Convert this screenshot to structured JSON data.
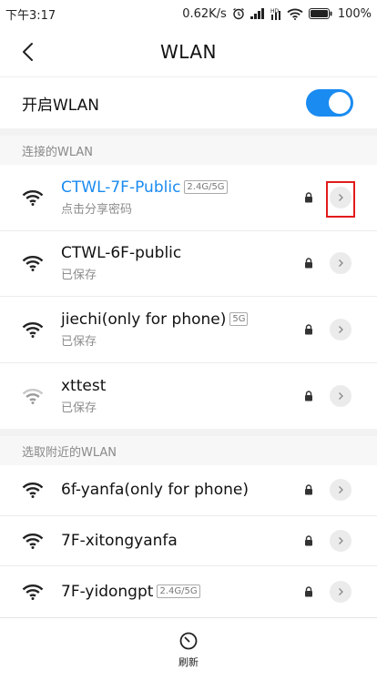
{
  "status_bar": {
    "time": "下午3:17",
    "speed": "0.62K/s",
    "battery": "100%",
    "icons": [
      "alarm-icon",
      "signal-icon",
      "hd-icon",
      "wifi-icon",
      "battery-icon"
    ]
  },
  "header": {
    "title": "WLAN",
    "back_icon": "back-arrow-icon"
  },
  "toggle": {
    "label": "开启WLAN",
    "enabled": true
  },
  "connected_section": {
    "title": "连接的WLAN",
    "items": [
      {
        "ssid": "CTWL-7F-Public",
        "badge": "2.4G/5G",
        "sub": "点击分享密码",
        "active": true,
        "locked": true,
        "signal": "strong"
      }
    ]
  },
  "saved_items": [
    {
      "ssid": "CTWL-6F-public",
      "badge": "",
      "sub": "已保存",
      "locked": true,
      "signal": "strong"
    },
    {
      "ssid": "jiechi(only for phone)",
      "badge": "5G",
      "sub": "已保存",
      "locked": true,
      "signal": "strong"
    },
    {
      "ssid": "xttest",
      "badge": "",
      "sub": "已保存",
      "locked": true,
      "signal": "weak"
    }
  ],
  "nearby_section": {
    "title": "选取附近的WLAN",
    "items": [
      {
        "ssid": "6f-yanfa(only for phone)",
        "badge": "",
        "locked": true,
        "signal": "strong"
      },
      {
        "ssid": "7F-xitongyanfa",
        "badge": "",
        "locked": true,
        "signal": "strong"
      },
      {
        "ssid": "7F-yidongpt",
        "badge": "2.4G/5G",
        "locked": true,
        "signal": "strong"
      }
    ]
  },
  "bottom_bar": {
    "refresh_label": "刷新",
    "refresh_icon": "refresh-icon"
  },
  "colors": {
    "accent": "#1a8bf0",
    "highlight": "#e21b1b"
  }
}
